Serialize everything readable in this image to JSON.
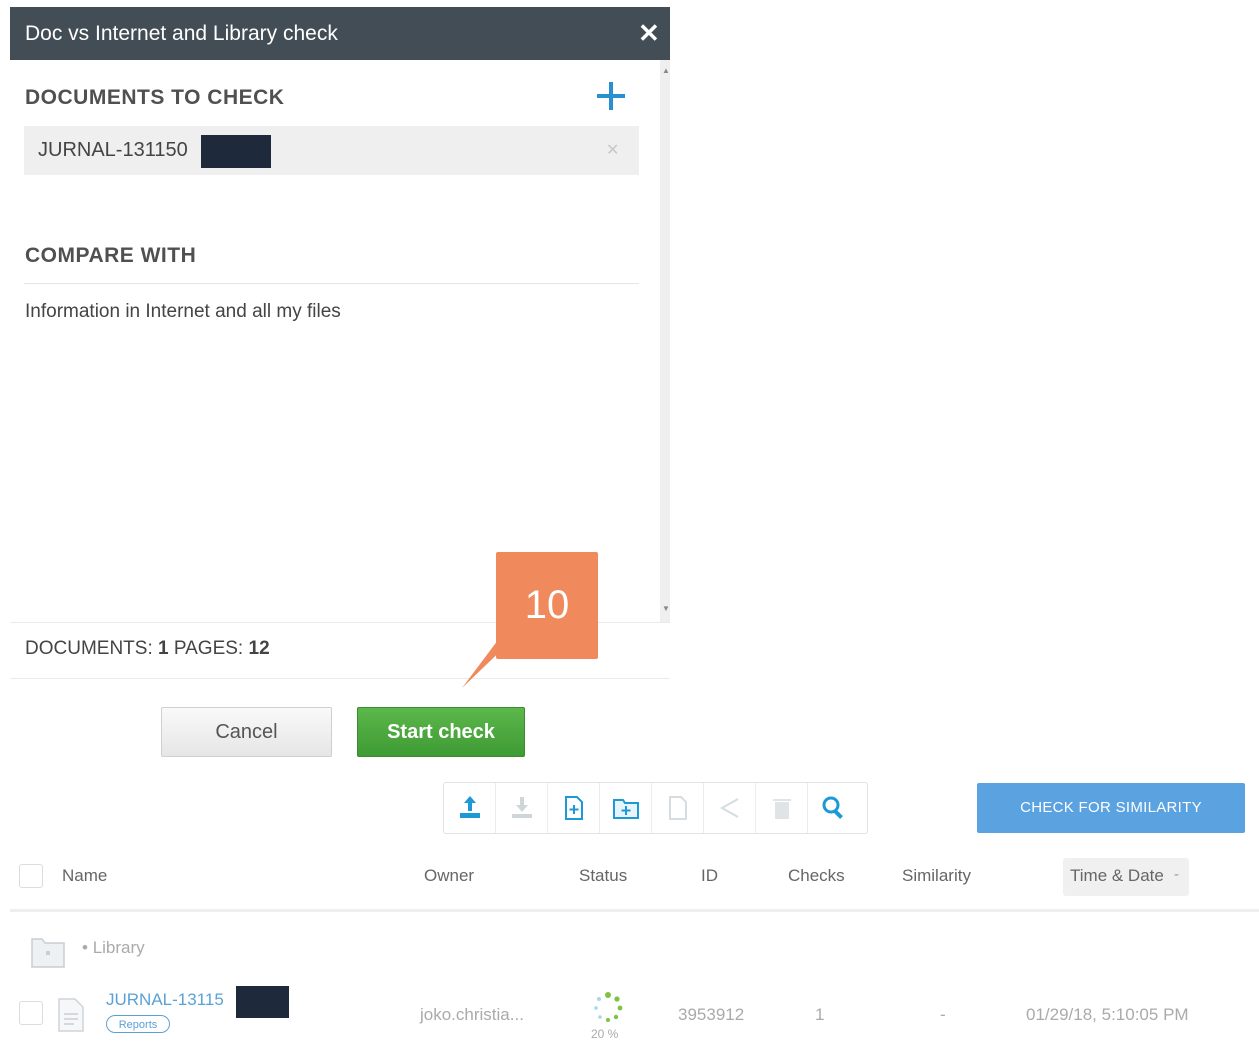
{
  "dialog": {
    "title": "Doc vs Internet and Library check",
    "close_icon": "close-icon",
    "documents_heading": "DOCUMENTS TO CHECK",
    "add_icon": "plus-icon",
    "document": {
      "name": "JURNAL-131150",
      "remove_icon": "close-icon"
    },
    "compare_heading": "COMPARE WITH",
    "compare_text": "Information in Internet and all my files",
    "footer": {
      "documents_label": "DOCUMENTS:",
      "documents_count": "1",
      "pages_label": "PAGES:",
      "pages_count": "12"
    },
    "cancel_label": "Cancel",
    "start_label": "Start check"
  },
  "callout": {
    "number": "10",
    "color": "#f08a5d"
  },
  "toolbar": {
    "buttons": [
      {
        "icon": "upload-icon",
        "enabled": true
      },
      {
        "icon": "download-icon",
        "enabled": false
      },
      {
        "icon": "new-file-icon",
        "enabled": true
      },
      {
        "icon": "new-folder-icon",
        "enabled": true
      },
      {
        "icon": "file-icon",
        "enabled": false
      },
      {
        "icon": "share-icon",
        "enabled": false
      },
      {
        "icon": "trash-icon",
        "enabled": false
      },
      {
        "icon": "search-icon",
        "enabled": true
      }
    ],
    "check_similarity_label": "CHECK FOR SIMILARITY"
  },
  "table": {
    "columns": [
      "Name",
      "Owner",
      "Status",
      "ID",
      "Checks",
      "Similarity",
      "Time & Date"
    ],
    "sort_indicator": "-",
    "folder": {
      "label": "Library",
      "bullet": "•"
    },
    "rows": [
      {
        "name": "JURNAL-13115",
        "badge": "Reports",
        "owner": "joko.christia...",
        "status_percent": "20 %",
        "id": "3953912",
        "checks": "1",
        "similarity": "-",
        "time_date": "01/29/18, 5:10:05 PM"
      }
    ]
  },
  "colors": {
    "header_bg": "#434d56",
    "start_green": "#4caf3f",
    "accent_blue": "#5aa2e0",
    "link_blue": "#5aa2d6"
  }
}
